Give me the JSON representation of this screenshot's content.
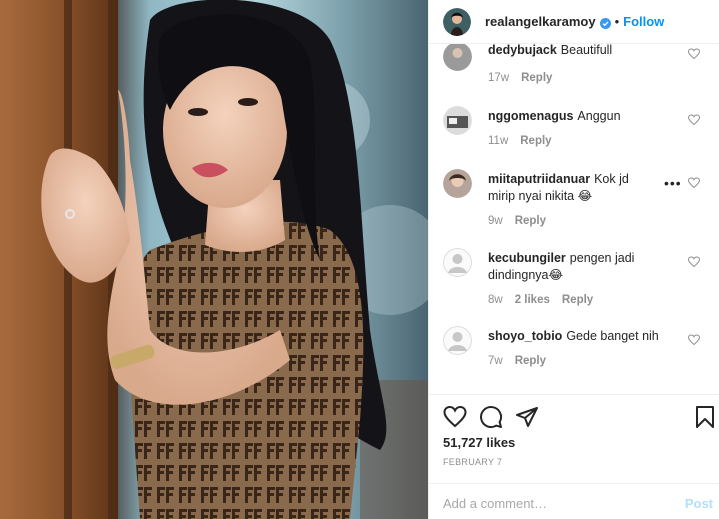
{
  "post": {
    "username": "realangelkaramoy",
    "verified_icon": "verified-badge-icon",
    "separator": "•",
    "follow_label": "Follow"
  },
  "comments": [
    {
      "user": "dedybujack",
      "text": "Beautifull",
      "time": "17w",
      "likes": "",
      "reply": "Reply"
    },
    {
      "user": "nggomenagus",
      "text": "Anggun",
      "time": "11w",
      "likes": "",
      "reply": "Reply"
    },
    {
      "user": "miitaputriidanuar",
      "text": "Kok jd mirip nyai nikita 😂",
      "time": "9w",
      "likes": "",
      "reply": "Reply"
    },
    {
      "user": "kecubungiler",
      "text": "pengen jadi dindingnya😂",
      "time": "8w",
      "likes": "2 likes",
      "reply": "Reply"
    },
    {
      "user": "shoyo_tobio",
      "text": "Gede banget nih",
      "time": "7w",
      "likes": "",
      "reply": "Reply"
    }
  ],
  "comment_more": "•••",
  "actions": {
    "like_icon": "heart-icon",
    "comment_icon": "comment-icon",
    "share_icon": "share-icon",
    "save_icon": "bookmark-icon",
    "likes_text": "51,727 likes",
    "date_text": "FEBRUARY 7"
  },
  "add_comment": {
    "placeholder": "Add a comment…",
    "post_label": "Post"
  },
  "colors": {
    "accent": "#0095f6",
    "muted": "#8e8e8e",
    "post_disabled": "#b2dffc"
  }
}
